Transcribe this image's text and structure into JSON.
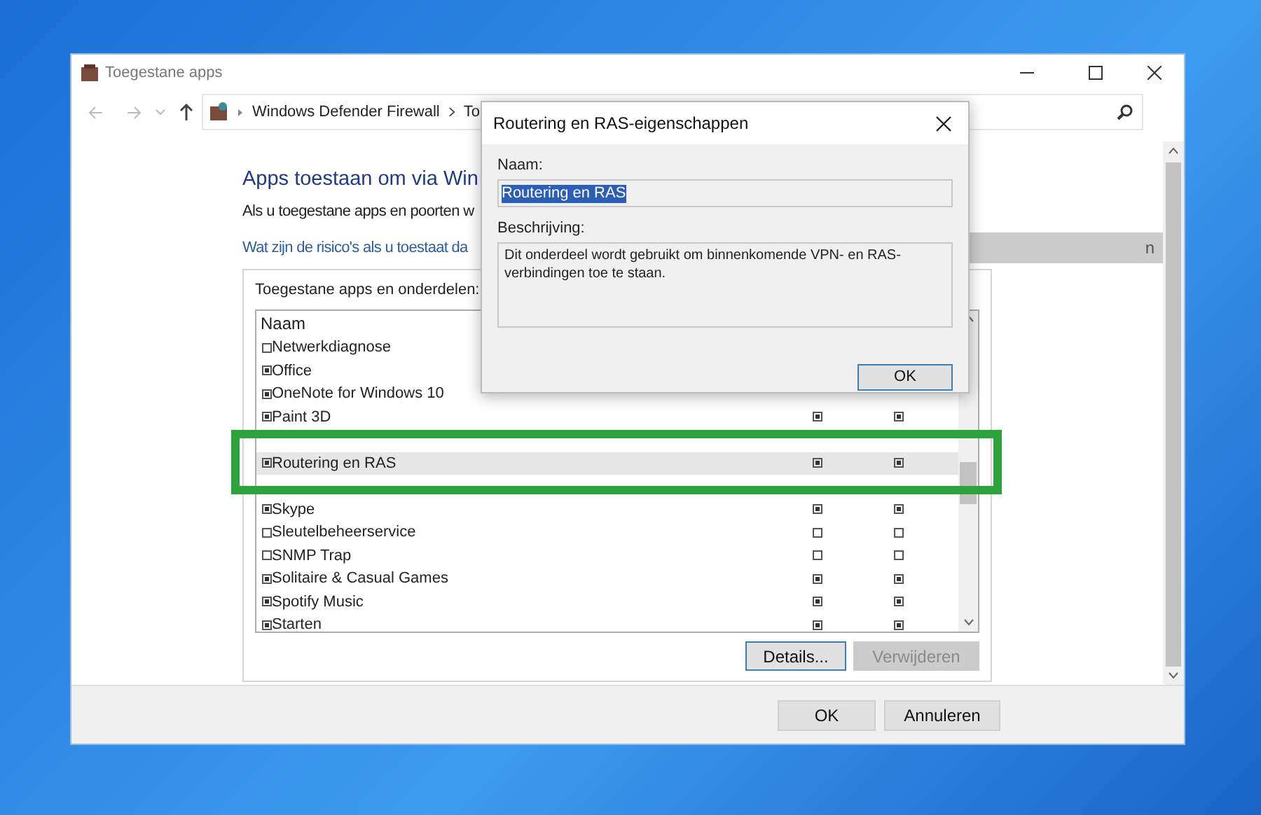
{
  "window": {
    "title": "Toegestane apps",
    "address": [
      "Windows Defender Firewall",
      "To"
    ]
  },
  "content": {
    "heading": "Apps toestaan om via Win",
    "intro": "Als u toegestane apps en poorten w",
    "risk_link": "Wat zijn de risico's als u toestaat da",
    "settings_button": "n"
  },
  "apps_group": {
    "label": "Toegestane apps en onderdelen:",
    "column_header": "Naam",
    "rows": [
      {
        "name": "Netwerkdiagnose",
        "checked": false,
        "selected": false
      },
      {
        "name": "Office",
        "checked": true,
        "selected": false
      },
      {
        "name": "OneNote for Windows 10",
        "checked": true,
        "selected": false
      },
      {
        "name": "Paint 3D",
        "checked": true,
        "selected": false,
        "private": true,
        "public": true
      },
      {
        "selected": false
      },
      {
        "name": "Routering en RAS",
        "checked": true,
        "selected": true,
        "private": true,
        "public": true
      },
      {
        "selected": false
      },
      {
        "name": "Skype",
        "checked": true,
        "selected": false,
        "private": true,
        "public": true
      },
      {
        "name": "Sleutelbeheerservice",
        "checked": false,
        "selected": false,
        "private": false,
        "public": false
      },
      {
        "name": "SNMP Trap",
        "checked": false,
        "selected": false,
        "private": false,
        "public": false
      },
      {
        "name": "Solitaire & Casual Games",
        "checked": true,
        "selected": false,
        "private": true,
        "public": true
      },
      {
        "name": "Spotify Music",
        "checked": true,
        "selected": false,
        "private": true,
        "public": true
      },
      {
        "name": "Starten",
        "checked": true,
        "selected": false,
        "private": true,
        "public": true
      }
    ],
    "buttons": [
      {
        "label": "Details...",
        "disabled": false
      },
      {
        "label": "Verwijderen",
        "disabled": true
      }
    ]
  },
  "footer_buttons": [
    "OK",
    "Annuleren"
  ],
  "dialog": {
    "title": "Routering en RAS-eigenschappen",
    "name_label": "Naam:",
    "name_value": "Routering en RAS",
    "description_label": "Beschrijving:",
    "description": "Dit onderdeel wordt gebruikt om binnenkomende VPN- en RAS-verbindingen toe te staan.",
    "ok": "OK"
  }
}
